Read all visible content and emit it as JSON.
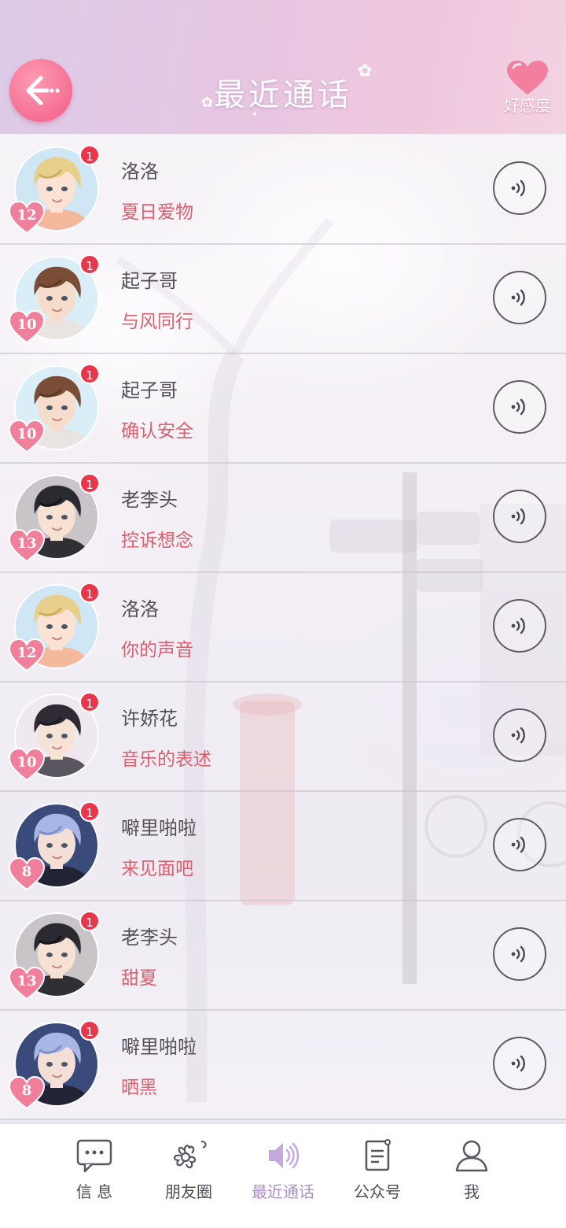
{
  "header": {
    "title": "最近通话",
    "back_icon": "arrow-left-icon",
    "affinity_label": "好感度",
    "affinity_icon": "heart-icon"
  },
  "colors": {
    "header_gradient": [
      "#dccbe8",
      "#f0c8dd"
    ],
    "back_button": "#f56f92",
    "badge": "#e8374b",
    "level_heart": "#f07f9c",
    "topic_text": "#d8606f",
    "nav_active": "#a98fc6"
  },
  "calls": [
    {
      "name": "洛洛",
      "topic": "夏日爱物",
      "level": "12",
      "badge": "1",
      "avatar": "blond"
    },
    {
      "name": "起子哥",
      "topic": "与风同行",
      "level": "10",
      "badge": "1",
      "avatar": "brown"
    },
    {
      "name": "起子哥",
      "topic": "确认安全",
      "level": "10",
      "badge": "1",
      "avatar": "brown"
    },
    {
      "name": "老李头",
      "topic": "控诉想念",
      "level": "13",
      "badge": "1",
      "avatar": "black"
    },
    {
      "name": "洛洛",
      "topic": "你的声音",
      "level": "12",
      "badge": "1",
      "avatar": "blond"
    },
    {
      "name": "许娇花",
      "topic": "音乐的表述",
      "level": "10",
      "badge": "1",
      "avatar": "darkhair"
    },
    {
      "name": "噼里啪啦",
      "topic": "来见面吧",
      "level": "8",
      "badge": "1",
      "avatar": "silver"
    },
    {
      "name": "老李头",
      "topic": "甜夏",
      "level": "13",
      "badge": "1",
      "avatar": "black"
    },
    {
      "name": "噼里啪啦",
      "topic": "晒黑",
      "level": "8",
      "badge": "1",
      "avatar": "silver"
    }
  ],
  "nav": [
    {
      "label": "信 息",
      "icon": "chat-bubble-icon",
      "active": false
    },
    {
      "label": "朋友圈",
      "icon": "flower-icon",
      "active": false
    },
    {
      "label": "最近通话",
      "icon": "speaker-icon",
      "active": true
    },
    {
      "label": "公众号",
      "icon": "document-icon",
      "active": false
    },
    {
      "label": "我",
      "icon": "person-icon",
      "active": false
    }
  ]
}
